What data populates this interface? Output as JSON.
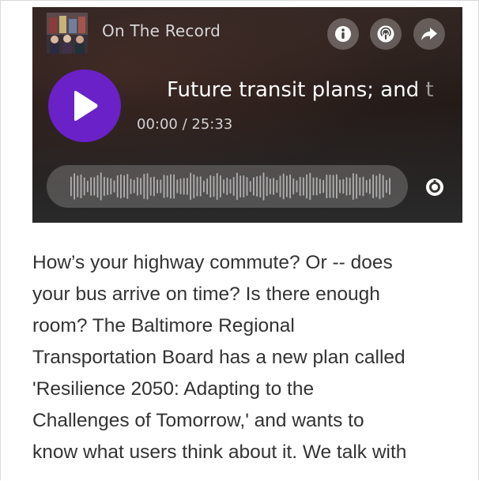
{
  "player": {
    "show_title": "On The Record",
    "episode_title": "Future transit plans; and t",
    "time_display": "00:00 / 25:33",
    "accent_color": "#6a21c7",
    "icons": {
      "info": "info-icon",
      "podcast": "podcast-icon",
      "share": "share-icon",
      "play": "play-icon",
      "settings": "settings-icon",
      "thumbnail": "show-thumbnail"
    }
  },
  "article": {
    "lines": [
      "How’s your highway commute? Or -- does",
      "your bus arrive on time? Is there enough",
      "room? The Baltimore Regional",
      "Transportation Board has a new plan called",
      "'Resilience 2050: Adapting to the",
      "Challenges of Tomorrow,' and wants to",
      "know what users think about it. We talk with"
    ]
  }
}
